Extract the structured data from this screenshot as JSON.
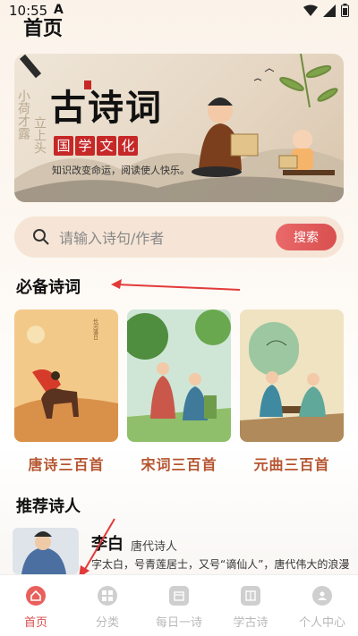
{
  "status": {
    "time": "10:55",
    "carrier_letter": "A"
  },
  "page": {
    "title": "首页"
  },
  "banner": {
    "title": "古诗词",
    "subtitle_chars": [
      "国",
      "学",
      "文",
      "化"
    ],
    "slogan": "知识改变命运，阅读使人快乐。"
  },
  "search": {
    "placeholder": "请输入诗句/作者",
    "button_label": "搜索"
  },
  "sections": {
    "essential": "必备诗词",
    "poets": "推荐诗人"
  },
  "collections": [
    {
      "label": "唐诗三百首",
      "icon": "horse-rider-illustration"
    },
    {
      "label": "宋词三百首",
      "icon": "scholars-garden-illustration"
    },
    {
      "label": "元曲三百首",
      "icon": "tea-gathering-illustration"
    }
  ],
  "poet": {
    "name": "李白",
    "dynasty": "唐代诗人",
    "description": "字太白，号青莲居士，又号“谪仙人”，唐代伟大的浪漫"
  },
  "tabs": [
    {
      "label": "首页",
      "icon": "home-icon",
      "active": true
    },
    {
      "label": "分类",
      "icon": "grid-icon",
      "active": false
    },
    {
      "label": "每日一诗",
      "icon": "calendar-icon",
      "active": false
    },
    {
      "label": "学古诗",
      "icon": "book-icon",
      "active": false
    },
    {
      "label": "个人中心",
      "icon": "user-icon",
      "active": false
    }
  ],
  "colors": {
    "accent": "#d94f4f",
    "card_label": "#b5542f",
    "search_bg": "#f6e5d6",
    "inactive_tab": "#b8b8b8"
  }
}
